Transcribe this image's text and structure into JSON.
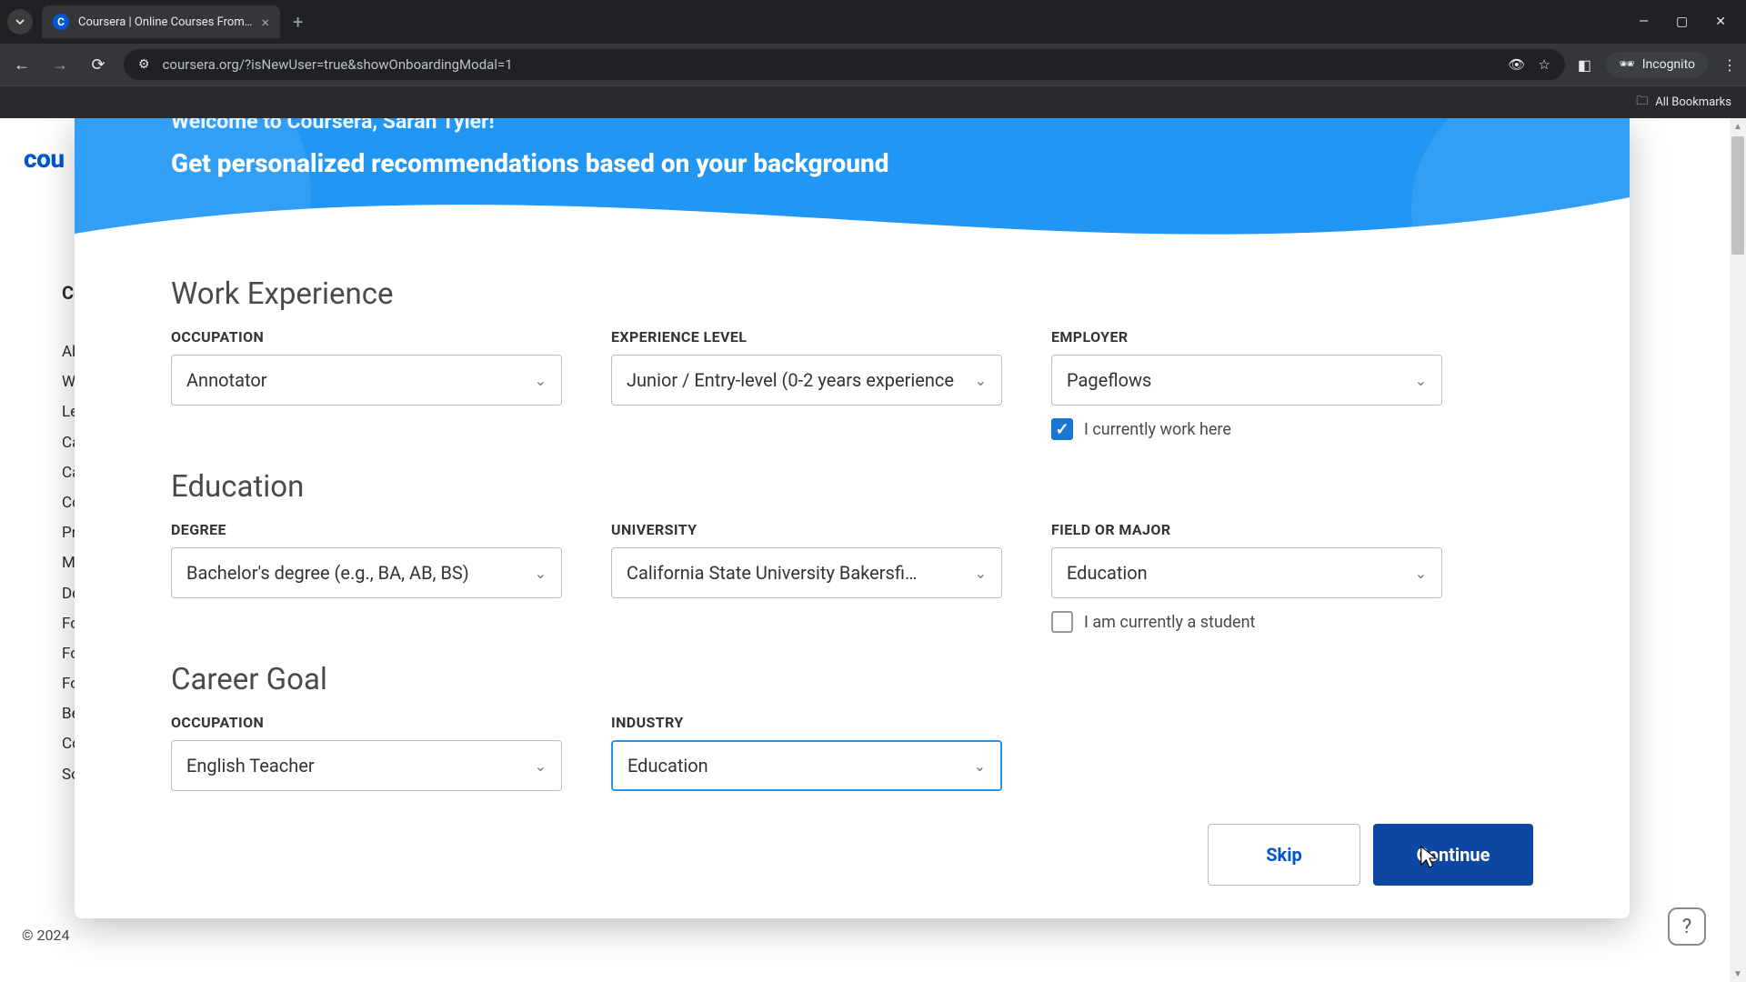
{
  "browser": {
    "tab_title": "Coursera | Online Courses From…",
    "url": "coursera.org/?isNewUser=true&showOnboardingModal=1",
    "incognito_label": "Incognito",
    "all_bookmarks": "All Bookmarks"
  },
  "background": {
    "logo_fragment": "cou",
    "sidebar_header": "Co",
    "links": [
      "Ab",
      "Wh",
      "Le",
      "Ca",
      "Ca",
      "Co",
      "Pr",
      "Ma",
      "De",
      "Fo",
      "Fo",
      "Fo",
      "Be",
      "Co",
      "So"
    ],
    "copyright": "© 2024 "
  },
  "modal": {
    "greeting": "Welcome to Coursera, Sarah Tyler!",
    "subtitle": "Get personalized recommendations based on your background",
    "sections": {
      "work": {
        "title": "Work Experience",
        "occupation": {
          "label": "OCCUPATION",
          "value": "Annotator"
        },
        "experience": {
          "label": "EXPERIENCE LEVEL",
          "value": "Junior / Entry-level (0-2 years experience"
        },
        "employer": {
          "label": "EMPLOYER",
          "value": "Pageflows"
        },
        "current_checkbox": "I currently work here"
      },
      "education": {
        "title": "Education",
        "degree": {
          "label": "DEGREE",
          "value": "Bachelor's degree (e.g., BA, AB, BS)"
        },
        "university": {
          "label": "UNIVERSITY",
          "value": "California State University Bakersfi…"
        },
        "major": {
          "label": "FIELD OR MAJOR",
          "value": "Education"
        },
        "student_checkbox": "I am currently a student"
      },
      "career": {
        "title": "Career Goal",
        "occupation": {
          "label": "OCCUPATION",
          "value": "English Teacher"
        },
        "industry": {
          "label": "INDUSTRY",
          "value": "Education"
        }
      }
    },
    "skip": "Skip",
    "continue": "Continue"
  }
}
